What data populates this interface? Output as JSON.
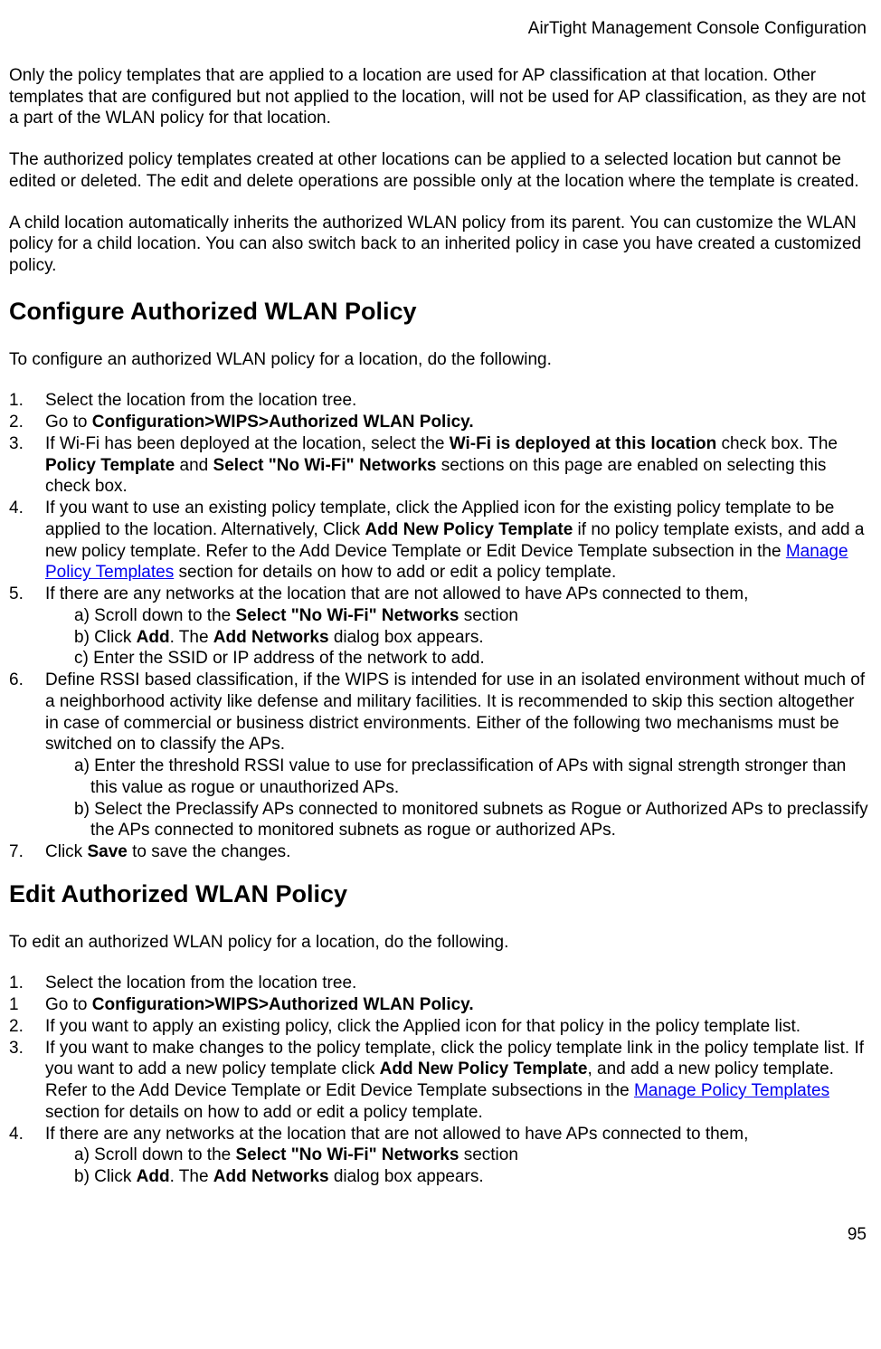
{
  "header": "AirTight Management Console Configuration",
  "pageNumber": "95",
  "para1": "Only the policy templates that are applied to a location are used for AP classification at that location. Other templates that are configured but not applied to the location, will not be used for AP classification, as they are not a part of the WLAN policy for that location.",
  "para2": "The authorized policy templates created at other locations can be applied to a selected location but cannot be edited or deleted. The edit and delete operations are possible only at the location where the template is created.",
  "para3": "A child location automatically inherits the authorized WLAN policy from its parent. You can customize the WLAN policy for a child location. You can also switch back to an inherited policy in case you have created a customized policy.",
  "section1": {
    "title": "Configure Authorized WLAN Policy",
    "intro": "To configure an authorized WLAN policy for a location, do the following.",
    "items": {
      "n1": "1.",
      "t1": "Select the location from the location tree.",
      "n2": "2.",
      "t2a": "Go to ",
      "t2b": "Configuration>WIPS>Authorized WLAN Policy.",
      "n3": "3.",
      "t3a": "If Wi-Fi has been deployed at the location, select the ",
      "t3b": "Wi-Fi is deployed at this location",
      "t3c": " check box. The ",
      "t3d": "Policy Template",
      "t3e": " and ",
      "t3f": "Select \"No Wi-Fi\" Networks",
      "t3g": " sections on this page are enabled on selecting this check box.",
      "n4": "4.",
      "t4a": "If you want to use an existing policy template, click the Applied icon for the existing policy template to be applied to the location. Alternatively, Click ",
      "t4b": "Add New Policy Template",
      "t4c": " if no policy template exists, and add a new policy template. Refer to the Add Device Template or Edit Device Template subsection in the ",
      "t4d": "Manage Policy Templates",
      "t4e": " section for details on how to add or edit a policy template.",
      "n5": "5.",
      "t5": "If there are any networks at the location that are not allowed to have APs connected to them,",
      "t5a1": "a) Scroll down to the ",
      "t5a2": "Select \"No Wi-Fi\" Networks",
      "t5a3": " section",
      "t5b1": "b) Click ",
      "t5b2": "Add",
      "t5b3": ". The ",
      "t5b4": "Add Networks",
      "t5b5": " dialog box appears.",
      "t5c": "c) Enter the SSID or IP address of the network to add.",
      "n6": "6.",
      "t6": "Define RSSI based classification, if the WIPS is intended for use in an isolated environment without much of a neighborhood activity like defense and military facilities. It is recommended to skip this section altogether in case of commercial or business district environments. Either of the following two mechanisms must be switched on to classify the APs.",
      "t6a": "a) Enter the threshold RSSI value to use for preclassification of APs with signal strength stronger than this value as rogue or unauthorized APs.",
      "t6b": "b) Select the Preclassify APs connected to monitored subnets as Rogue or Authorized APs to preclassify the APs connected to monitored subnets as rogue or authorized APs.",
      "n7": "7.",
      "t7a": "Click ",
      "t7b": "Save",
      "t7c": " to save the changes."
    }
  },
  "section2": {
    "title": "Edit Authorized WLAN Policy",
    "intro": "To edit an authorized WLAN policy for a location, do the following.",
    "items": {
      "n1": "1.",
      "t1": "Select the location from the location tree.",
      "n1b": "1",
      "t1ba": " Go to ",
      "t1bb": "Configuration>WIPS>Authorized WLAN Policy.",
      "n2": "2.",
      "t2": "If you want to apply an existing policy, click the Applied icon for that policy in the policy template list.",
      "n3": "3.",
      "t3a": "If you want to make changes to the policy template, click the policy template link in the policy template list. If you want to add a new policy template click ",
      "t3b": "Add New Policy Template",
      "t3c": ", and add a new policy template. Refer to the Add Device Template or Edit Device Template subsections in the ",
      "t3d": "Manage Policy Templates",
      "t3e": " section for details on how to add or edit a policy template.",
      "n4": "4.",
      "t4": "If there are any networks at the location that are not allowed to have APs connected to them,",
      "t4a1": "a) Scroll down to the ",
      "t4a2": "Select \"No Wi-Fi\" Networks",
      "t4a3": " section",
      "t4b1": "b) Click ",
      "t4b2": "Add",
      "t4b3": ". The ",
      "t4b4": "Add Networks",
      "t4b5": " dialog box appears."
    }
  }
}
